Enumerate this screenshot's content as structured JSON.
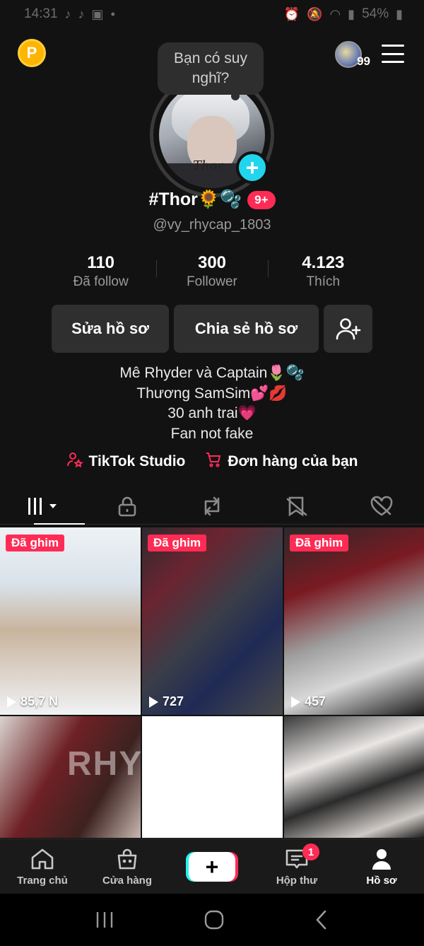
{
  "status_bar": {
    "time": "14:31",
    "battery": "54%"
  },
  "topbar": {
    "coin_label": "P",
    "story_count": "99"
  },
  "thought_bubble": {
    "text": "Bạn có suy nghĩ?"
  },
  "profile": {
    "avatar_signature": "Thor",
    "display_name": "#Thor🌻🫧",
    "notification_badge": "9+",
    "username": "@vy_rhycap_1803"
  },
  "stats": [
    {
      "value": "110",
      "label": "Đã follow"
    },
    {
      "value": "300",
      "label": "Follower"
    },
    {
      "value": "4.123",
      "label": "Thích"
    }
  ],
  "actions": {
    "edit": "Sửa hồ sơ",
    "share": "Chia sẻ hồ sơ"
  },
  "bio": [
    "Mê Rhyder và Captain🌷🫧",
    "Thương SamSim💕💋",
    "30 anh trai💗",
    "Fan not fake"
  ],
  "links": {
    "studio": "TikTok Studio",
    "orders": "Đơn hàng của bạn"
  },
  "videos": [
    {
      "pinned": "Đã ghim",
      "views": "85,7 N"
    },
    {
      "pinned": "Đã ghim",
      "views": "727"
    },
    {
      "pinned": "Đã ghim",
      "views": "457"
    },
    {
      "overlay": "RHY"
    }
  ],
  "bottom_nav": {
    "home": "Trang chủ",
    "shop": "Cửa hàng",
    "inbox": "Hộp thư",
    "inbox_badge": "1",
    "profile": "Hồ sơ"
  },
  "colors": {
    "accent": "#fe2c55",
    "cyan": "#25f4ee",
    "background": "#121212"
  }
}
